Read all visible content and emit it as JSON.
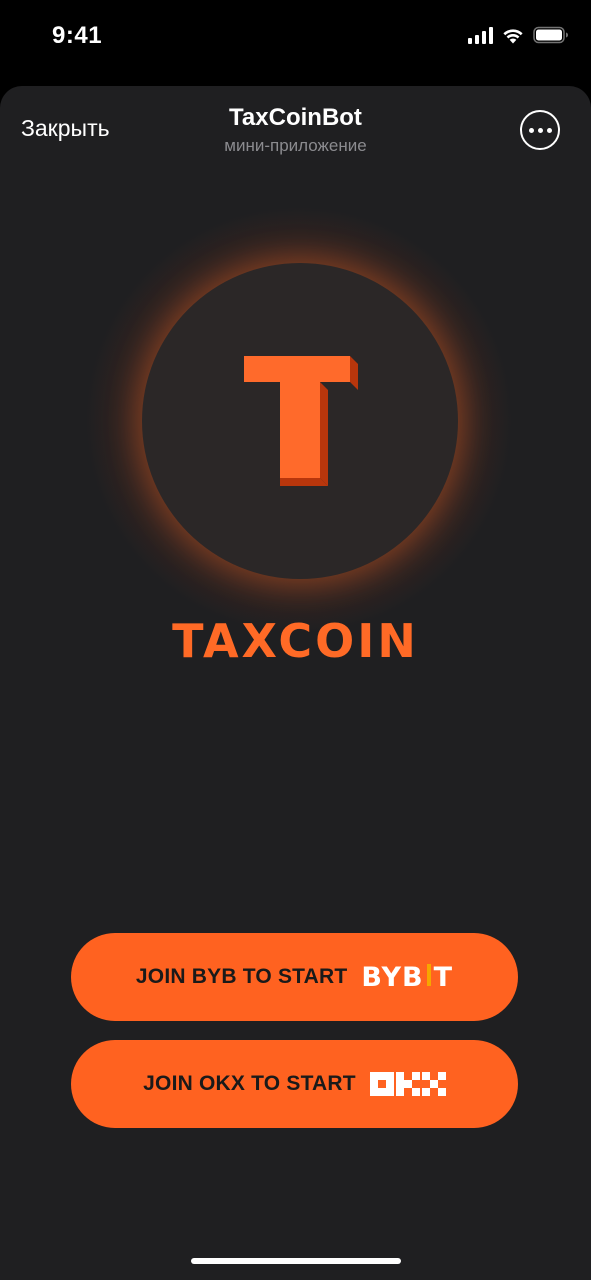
{
  "status_bar": {
    "time": "9:41",
    "icons": [
      "signal-icon",
      "wifi-icon",
      "battery-icon"
    ]
  },
  "header": {
    "close_label": "Закрыть",
    "title": "TaxCoinBot",
    "subtitle": "мини-приложение",
    "more_icon": "more-icon"
  },
  "hero": {
    "logo_icon": "taxcoin-t-logo-icon",
    "brand_name": "TAXCOIN"
  },
  "actions": {
    "bybit_label": "JOIN BYB TO START",
    "bybit_logo": "BYB T",
    "okx_label": "JOIN OKX TO START",
    "okx_logo_icon": "okx-logo-icon"
  },
  "colors": {
    "accent": "#ff6220",
    "brand_text": "#ff6a26",
    "sheet_background": "#1f1f21",
    "coin_background": "#2b2727",
    "bybit_yellow": "#f7a600"
  }
}
